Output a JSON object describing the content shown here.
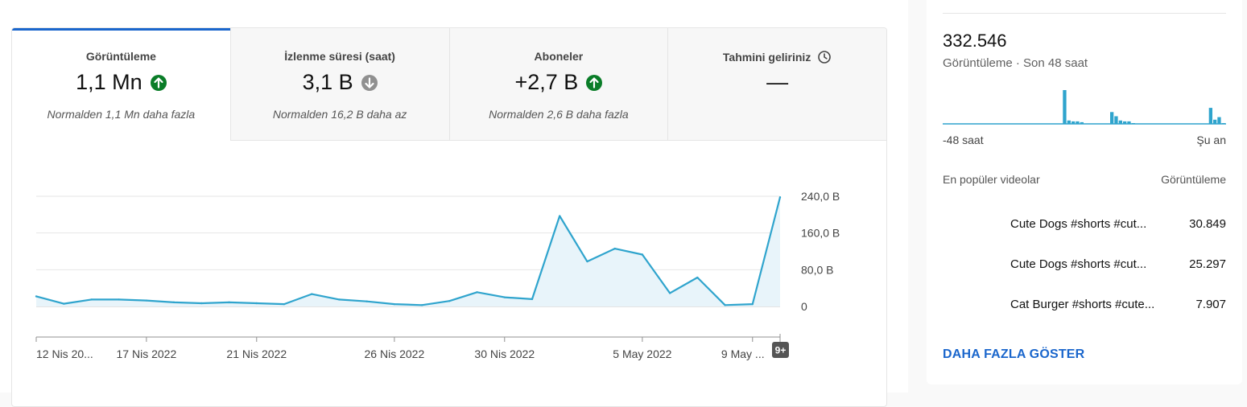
{
  "metrics": [
    {
      "label": "Görüntüleme",
      "value": "1,1 Mn",
      "trend": "up",
      "note": "Normalden 1,1 Mn daha fazla"
    },
    {
      "label": "İzlenme süresi (saat)",
      "value": "3,1 B",
      "trend": "down",
      "note": "Normalden 16,2 B daha az"
    },
    {
      "label": "Aboneler",
      "value": "+2,7 B",
      "trend": "up",
      "note": "Normalden 2,6 B daha fazla"
    },
    {
      "label": "Tahmini geliriniz",
      "value": "—",
      "icon": "clock-icon"
    }
  ],
  "colors": {
    "accent": "#1a66cc",
    "up": "#0a7d28",
    "down": "#909090",
    "line": "#2fa4cd",
    "fill": "#e8f4fa"
  },
  "chart_data": {
    "type": "area",
    "x": [
      "12 Nis 2022",
      "13 Nis 2022",
      "14 Nis 2022",
      "15 Nis 2022",
      "16 Nis 2022",
      "17 Nis 2022",
      "18 Nis 2022",
      "19 Nis 2022",
      "20 Nis 2022",
      "21 Nis 2022",
      "22 Nis 2022",
      "23 Nis 2022",
      "24 Nis 2022",
      "25 Nis 2022",
      "26 Nis 2022",
      "27 Nis 2022",
      "28 Nis 2022",
      "29 Nis 2022",
      "30 Nis 2022",
      "1 May 2022",
      "2 May 2022",
      "3 May 2022",
      "4 May 2022",
      "5 May 2022",
      "6 May 2022",
      "7 May 2022",
      "8 May 2022",
      "9 May 2022"
    ],
    "series": [
      {
        "values": [
          22,
          6,
          15,
          15,
          13,
          9,
          7,
          9,
          7,
          5,
          27,
          15,
          11,
          5,
          3,
          12,
          31,
          20,
          16,
          197,
          98,
          126,
          113,
          29,
          63,
          3,
          5,
          238
        ]
      }
    ],
    "tick_labels": [
      "12 Nis 20...",
      "17 Nis 2022",
      "21 Nis 2022",
      "26 Nis 2022",
      "30 Nis 2022",
      "5 May 2022",
      "9 May ..."
    ],
    "tick_indices": [
      0,
      4,
      8,
      13,
      17,
      22,
      26
    ],
    "y_ticks": [
      0,
      80,
      160,
      240
    ],
    "y_tick_labels": [
      "0",
      "80,0 B",
      "160,0 B",
      "240,0 B"
    ],
    "ylim": [
      0,
      240
    ],
    "grid": true,
    "badge": "9+"
  },
  "realtime": {
    "value": "332.546",
    "subtitle": "Görüntüleme · Son 48 saat",
    "left_label": "-48 saat",
    "right_label": "Şu an",
    "bars": [
      0,
      0,
      0,
      0,
      0,
      0,
      0,
      0,
      0,
      0,
      0,
      0,
      0,
      0,
      0,
      0,
      0,
      0,
      0,
      0,
      0,
      0,
      0,
      0,
      0,
      0,
      0,
      0,
      40,
      4,
      3,
      3,
      2,
      0,
      0,
      0,
      0,
      0,
      0,
      14,
      9,
      4,
      3,
      3,
      1,
      0,
      0,
      0,
      0,
      0,
      0,
      0,
      0,
      0,
      0,
      0,
      0,
      0,
      0,
      0,
      0,
      0,
      19,
      5,
      8,
      1
    ]
  },
  "top_videos": {
    "header_left": "En popüler videolar",
    "header_right": "Görüntüleme",
    "items": [
      {
        "title": "Cute Dogs #shorts #cut...",
        "views": "30.849"
      },
      {
        "title": "Cute Dogs #shorts #cut...",
        "views": "25.297"
      },
      {
        "title": "Cat Burger #shorts #cute...",
        "views": "7.907"
      }
    ],
    "show_more": "DAHA FAZLA GÖSTER"
  }
}
